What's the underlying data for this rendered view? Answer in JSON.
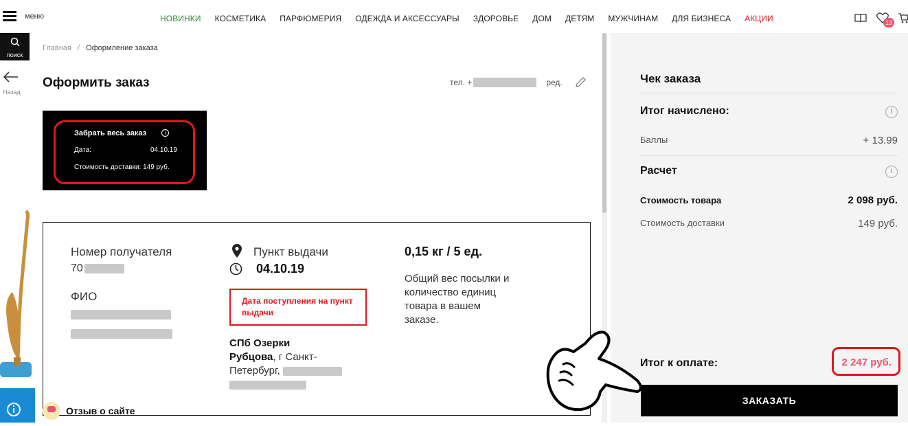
{
  "header": {
    "menu_label": "меню",
    "nav": [
      {
        "label": "НОВИНКИ",
        "color": "#2e8b3d"
      },
      {
        "label": "КОСМЕТИКА"
      },
      {
        "label": "ПАРФЮМЕРИЯ"
      },
      {
        "label": "ОДЕЖДА И АКСЕССУАРЫ"
      },
      {
        "label": "ЗДОРОВЬЕ"
      },
      {
        "label": "ДОМ"
      },
      {
        "label": "ДЕТЯМ"
      },
      {
        "label": "МУЖЧИНАМ"
      },
      {
        "label": "ДЛЯ БИЗНЕСА"
      },
      {
        "label": "АКЦИИ",
        "color": "#d6202a"
      }
    ],
    "wishlist_count": "13",
    "icons": [
      "book-icon",
      "heart-icon",
      "cart-icon"
    ]
  },
  "sidebar": {
    "search_label": "поиск",
    "back_label": "Назад"
  },
  "breadcrumb": {
    "home": "Главная",
    "separator": "/",
    "current": "Оформление заказа"
  },
  "page": {
    "title": "Оформить заказ",
    "phone_prefix": "тел. +",
    "edit_label": "ред."
  },
  "summary": {
    "title": "Забрать весь заказ",
    "date_label": "Дата:",
    "date_value": "04.10.19",
    "delivery_cost": "Стоимость доставки: 149 руб."
  },
  "card": {
    "recipient_number_label": "Номер получателя",
    "recipient_number_value": "70",
    "name_label": "ФИО",
    "pickup_label": "Пункт выдачи",
    "pickup_date": "04.10.19",
    "arrival_note": "Дата поступления на пункт выдачи",
    "address_bold_1": "СПб Озерки",
    "address_bold_2": "Рубцова",
    "address_rest_1": ", г Санкт-",
    "address_rest_2": "Петербург,",
    "weight": "0,15 кг / 5  ед.",
    "weight_desc": "Общий вес посылки и количество единиц товара в вашем заказе."
  },
  "feedback": {
    "label": "Отзыв о сайте"
  },
  "receipt": {
    "title": "Чек заказа",
    "accrued_title": "Итог начислено:",
    "points_label": "Баллы",
    "points_value": "+ 13.99",
    "calc_title": "Расчет",
    "goods_label": "Стоимость товара",
    "goods_value": "2 098 руб.",
    "delivery_label": "Стоимость доставки",
    "delivery_value": "149 руб.",
    "total_label": "Итог к оплате:",
    "total_value": "2 247 руб.",
    "order_button": "ЗАКАЗАТЬ"
  }
}
